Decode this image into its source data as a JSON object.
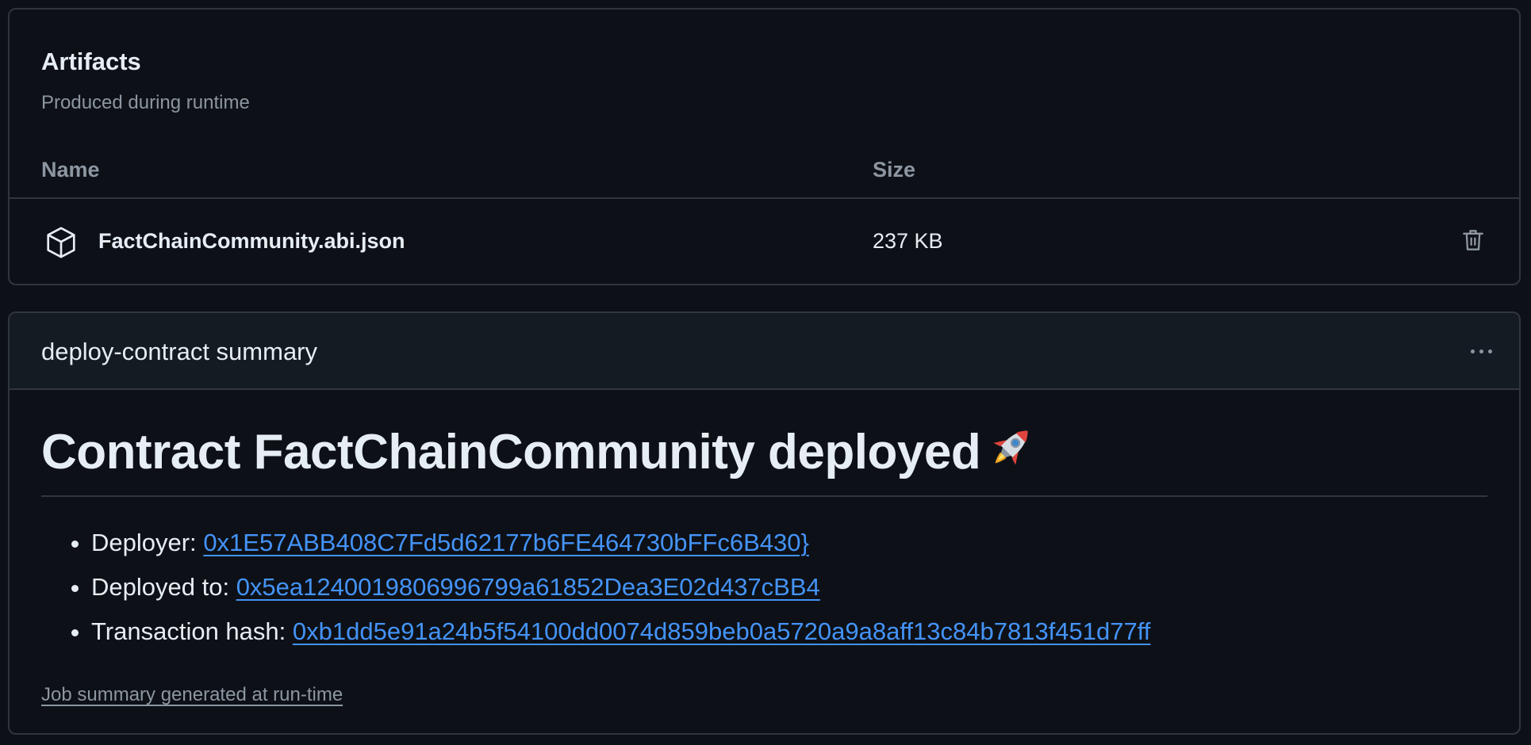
{
  "artifacts": {
    "title": "Artifacts",
    "subtitle": "Produced during runtime",
    "columns": {
      "name": "Name",
      "size": "Size"
    },
    "items": [
      {
        "name": "FactChainCommunity.abi.json",
        "size": "237 KB",
        "icon": "package-icon",
        "action_icon": "trash-icon"
      }
    ]
  },
  "summary": {
    "header_title": "deploy-contract summary",
    "menu_icon": "kebab-horizontal-icon",
    "heading": "Contract FactChainCommunity deployed",
    "heading_emoji": "rocket-icon",
    "items": [
      {
        "label": "Deployer:",
        "value": "0x1E57ABB408C7Fd5d62177b6FE464730bFFc6B430}"
      },
      {
        "label": "Deployed to:",
        "value": "0x5ea1240019806996799a61852Dea3E02d437cBB4"
      },
      {
        "label": "Transaction hash:",
        "value": "0xb1dd5e91a24b5f54100dd0074d859beb0a5720a9a8aff13c84b7813f451d77ff"
      }
    ],
    "footer_note": "Job summary generated at run-time"
  },
  "colors": {
    "background": "#0d1117",
    "header_background": "#151b23",
    "border": "#30363d",
    "text": "#e6edf3",
    "muted": "#8d96a0",
    "link": "#4493f8"
  }
}
